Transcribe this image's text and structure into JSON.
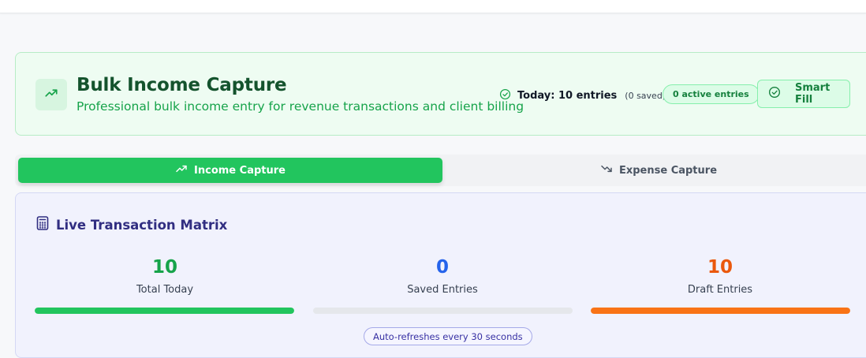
{
  "header": {
    "title": "Bulk Income Capture",
    "subtitle": "Professional bulk income entry for revenue transactions and client billing",
    "today_label": "Today: 10 entries",
    "saved_note": "(0 saved)",
    "active_badge": "0 active entries",
    "smart_fill_label": "Smart Fill"
  },
  "tabs": [
    {
      "label": "Income Capture",
      "icon": "trending-up-icon",
      "active": true
    },
    {
      "label": "Expense Capture",
      "icon": "trending-down-icon",
      "active": false
    }
  ],
  "matrix": {
    "title": "Live Transaction Matrix",
    "stats": [
      {
        "value": "10",
        "label": "Total Today",
        "color": "#16a34a",
        "bar_color": "#22c55e",
        "progress": 1.0
      },
      {
        "value": "0",
        "label": "Saved Entries",
        "color": "#2563eb",
        "bar_color": "#3b82f6",
        "progress": 0.0
      },
      {
        "value": "10",
        "label": "Draft Entries",
        "color": "#ea580c",
        "bar_color": "#f97316",
        "progress": 1.0
      }
    ],
    "refresh_note": "Auto-refreshes every 30 seconds"
  },
  "colors": {
    "accent": "#22c55e",
    "header_title": "#14532d",
    "matrix_title": "#312e81"
  }
}
